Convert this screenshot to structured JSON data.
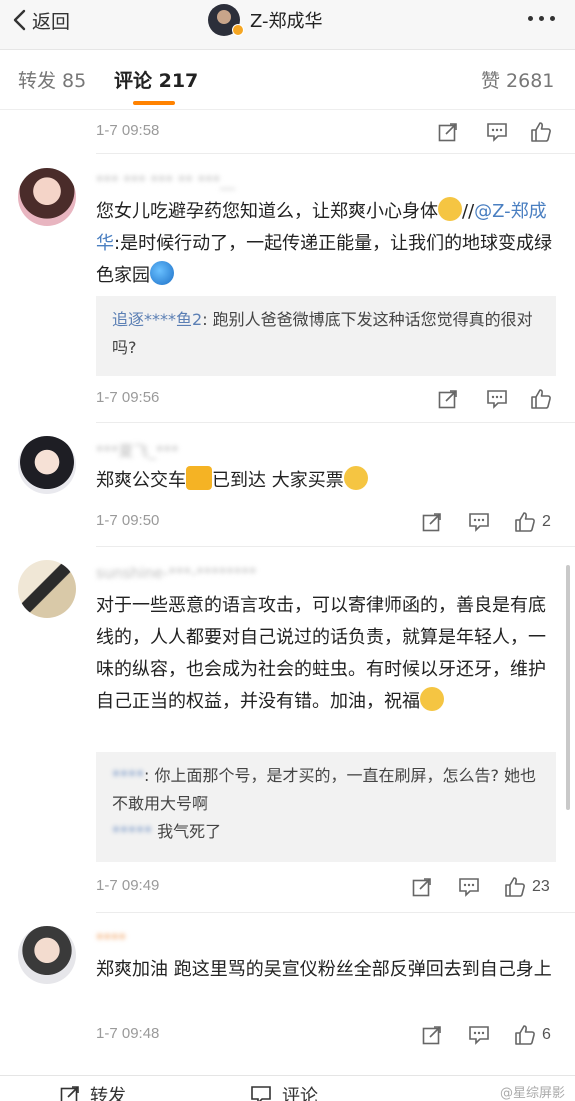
{
  "nav": {
    "back_label": "返回",
    "title": "Z-郑成华"
  },
  "tabs": {
    "repost": "转发 85",
    "comment": "评论 217",
    "like": "赞 2681"
  },
  "top_meta": {
    "time": "1-7 09:58"
  },
  "comments": [
    {
      "user": "*** *** *** ** ***__",
      "text_a": "您女儿吃避孕药您知道么，让郑爽小心身体",
      "text_b": "//",
      "mention": "@Z-郑成华",
      "text_c": ":是时候行动了，一起传递正能量，让我们的地球变成绿色家园",
      "reply_user": "追逐****鱼2",
      "reply_text": ": 跑别人爸爸微博底下发这种话您觉得真的很对吗?",
      "time": "1-7 09:56",
      "likes": ""
    },
    {
      "user": "***夏飞_***",
      "text": "郑爽公交车",
      "text_b": "已到达 大家买票",
      "time": "1-7 09:50",
      "likes": "2"
    },
    {
      "user": "sunshine-***-********",
      "text": "对于一些恶意的语言攻击，可以寄律师函的，善良是有底线的，人人都要对自己说过的话负责，就算是年轻人，一味的纵容，也会成为社会的蛀虫。有时候以牙还牙，维护自己正当的权益，并没有错。加油，祝福",
      "reply_user": "****",
      "reply_text": ": 你上面那个号，是才买的，一直在刷屏，怎么告? 她也不敢用大号啊",
      "reply2_user": "*****",
      "reply2_text": "我气死了",
      "time": "1-7 09:49",
      "likes": "23"
    },
    {
      "user": "****",
      "text": "郑爽加油 跑这里骂的吴宣仪粉丝全部反弹回去到自己身上",
      "time": "1-7 09:48",
      "likes": "6"
    }
  ],
  "bottom": {
    "repost": "转发",
    "comment": "评论",
    "watermark": "@星综屏影"
  }
}
